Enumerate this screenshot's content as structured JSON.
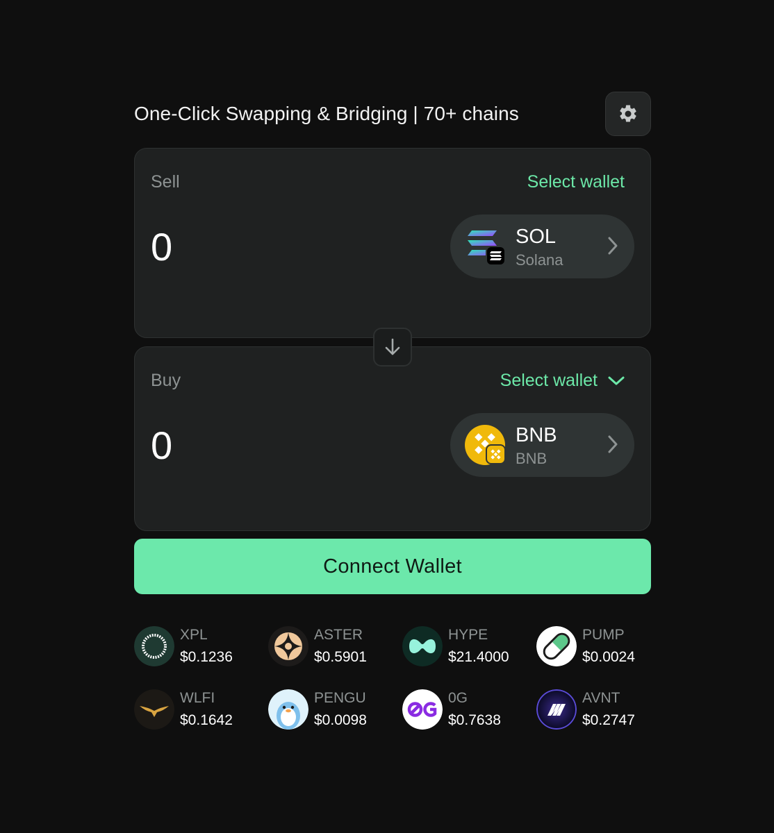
{
  "header": {
    "title": "One-Click Swapping & Bridging | 70+ chains",
    "settings_icon": "gear-icon"
  },
  "sell": {
    "label": "Sell",
    "wallet_action": "Select wallet",
    "amount": "0",
    "token": {
      "symbol": "SOL",
      "chain": "Solana",
      "icon": "solana-icon"
    }
  },
  "swap_icon": "arrow-down-icon",
  "buy": {
    "label": "Buy",
    "wallet_action": "Select wallet",
    "amount": "0",
    "token": {
      "symbol": "BNB",
      "chain": "BNB",
      "icon": "bnb-icon"
    }
  },
  "connect_label": "Connect Wallet",
  "tickers": [
    {
      "symbol": "XPL",
      "price": "$0.1236",
      "icon": "xpl-icon"
    },
    {
      "symbol": "ASTER",
      "price": "$0.5901",
      "icon": "aster-icon"
    },
    {
      "symbol": "HYPE",
      "price": "$21.4000",
      "icon": "hype-icon"
    },
    {
      "symbol": "PUMP",
      "price": "$0.0024",
      "icon": "pump-icon"
    },
    {
      "symbol": "WLFI",
      "price": "$0.1642",
      "icon": "wlfi-icon"
    },
    {
      "symbol": "PENGU",
      "price": "$0.0098",
      "icon": "pengu-icon"
    },
    {
      "symbol": "0G",
      "price": "$0.7638",
      "icon": "0g-icon"
    },
    {
      "symbol": "AVNT",
      "price": "$0.2747",
      "icon": "avnt-icon"
    }
  ],
  "colors": {
    "background": "#0f0f0f",
    "panel": "#1f2121",
    "accent": "#6ce8ab",
    "muted_text": "#8e9393"
  }
}
